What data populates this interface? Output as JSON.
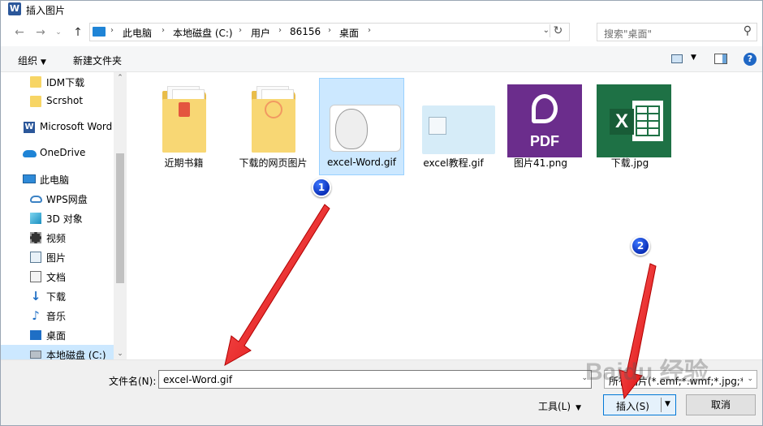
{
  "window": {
    "title": "插入图片",
    "app_icon_letter": "W"
  },
  "nav": {
    "breadcrumb": [
      "此电脑",
      "本地磁盘 (C:)",
      "用户",
      "86156",
      "桌面"
    ],
    "search_placeholder": "搜索\"桌面\""
  },
  "toolbar": {
    "organize": "组织",
    "new_folder": "新建文件夹"
  },
  "sidebar": {
    "items": [
      {
        "label": "IDM下载",
        "icon": "folder-icon"
      },
      {
        "label": "Scrshot",
        "icon": "folder-icon"
      },
      {
        "label": "Microsoft Word",
        "icon": "word-icon"
      },
      {
        "label": "OneDrive",
        "icon": "cloud-icon"
      },
      {
        "label": "此电脑",
        "icon": "computer-icon"
      },
      {
        "label": "WPS网盘",
        "icon": "cloud-icon"
      },
      {
        "label": "3D 对象",
        "icon": "cube-icon"
      },
      {
        "label": "视频",
        "icon": "video-icon"
      },
      {
        "label": "图片",
        "icon": "picture-icon"
      },
      {
        "label": "文档",
        "icon": "document-icon"
      },
      {
        "label": "下载",
        "icon": "download-icon"
      },
      {
        "label": "音乐",
        "icon": "music-icon"
      },
      {
        "label": "桌面",
        "icon": "desktop-icon"
      },
      {
        "label": "本地磁盘 (C:)",
        "icon": "drive-icon"
      }
    ]
  },
  "files": [
    {
      "name": "近期书籍",
      "kind": "folder"
    },
    {
      "name": "下载的网页图片",
      "kind": "folder"
    },
    {
      "name": "excel-Word.gif",
      "kind": "meme",
      "selected": true
    },
    {
      "name": "excel教程.gif",
      "kind": "illustration"
    },
    {
      "name": "图片41.png",
      "kind": "pdf-logo",
      "text": "PDF"
    },
    {
      "name": "下载.jpg",
      "kind": "excel-logo",
      "text": "X"
    }
  ],
  "bottom": {
    "filename_label": "文件名(N):",
    "filename_value": "excel-Word.gif",
    "filetype_value": "所有图片(*.emf;*.wmf;*.jpg;*.jp",
    "tools_label": "工具(L)",
    "insert_label": "插入(S)",
    "cancel_label": "取消"
  },
  "annotations": {
    "badge1": "1",
    "badge2": "2",
    "watermark": "Baidu 经验"
  },
  "colors": {
    "selection": "#cce8ff",
    "accent": "#0078d7",
    "arrow": "#ee1111"
  }
}
